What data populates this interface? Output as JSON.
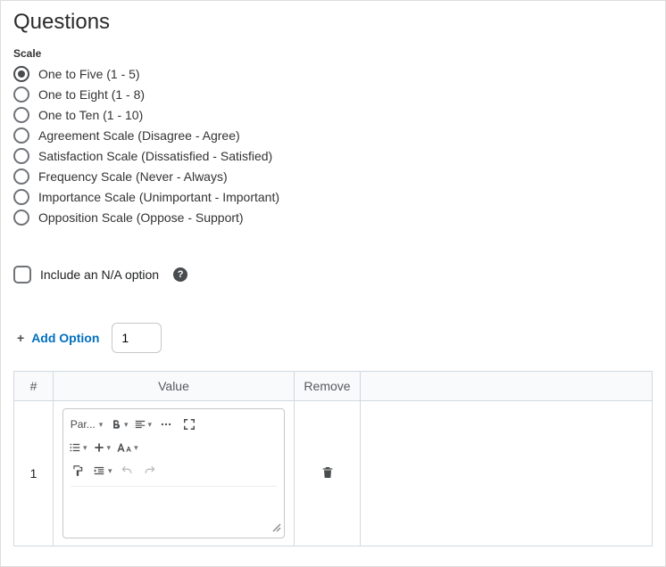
{
  "title": "Questions",
  "scale": {
    "label": "Scale",
    "selected_index": 0,
    "options": [
      "One to Five (1 - 5)",
      "One to Eight (1 - 8)",
      "One to Ten (1 - 10)",
      "Agreement Scale (Disagree - Agree)",
      "Satisfaction Scale (Dissatisfied - Satisfied)",
      "Frequency Scale (Never - Always)",
      "Importance Scale (Unimportant - Important)",
      "Opposition Scale (Oppose - Support)"
    ]
  },
  "na_option": {
    "label": "Include an N/A option",
    "checked": false,
    "help_glyph": "?"
  },
  "add_option": {
    "label": "Add Option",
    "plus": "+",
    "count": "1"
  },
  "table": {
    "headers": {
      "num": "#",
      "value": "Value",
      "remove": "Remove",
      "blank": ""
    },
    "rows": [
      {
        "num": "1",
        "value_text": ""
      }
    ]
  },
  "editor_toolbar": {
    "paragraph_selector": "Par...",
    "icons": {
      "bold": "bold-icon",
      "align": "align-icon",
      "more": "more-icon",
      "fullscreen": "fullscreen-icon",
      "list": "list-icon",
      "insert_plus": "insert-plus-icon",
      "font_size": "font-size-icon",
      "format_paint": "format-paint-icon",
      "indent": "indent-icon",
      "undo": "undo-icon",
      "redo": "redo-icon"
    }
  }
}
